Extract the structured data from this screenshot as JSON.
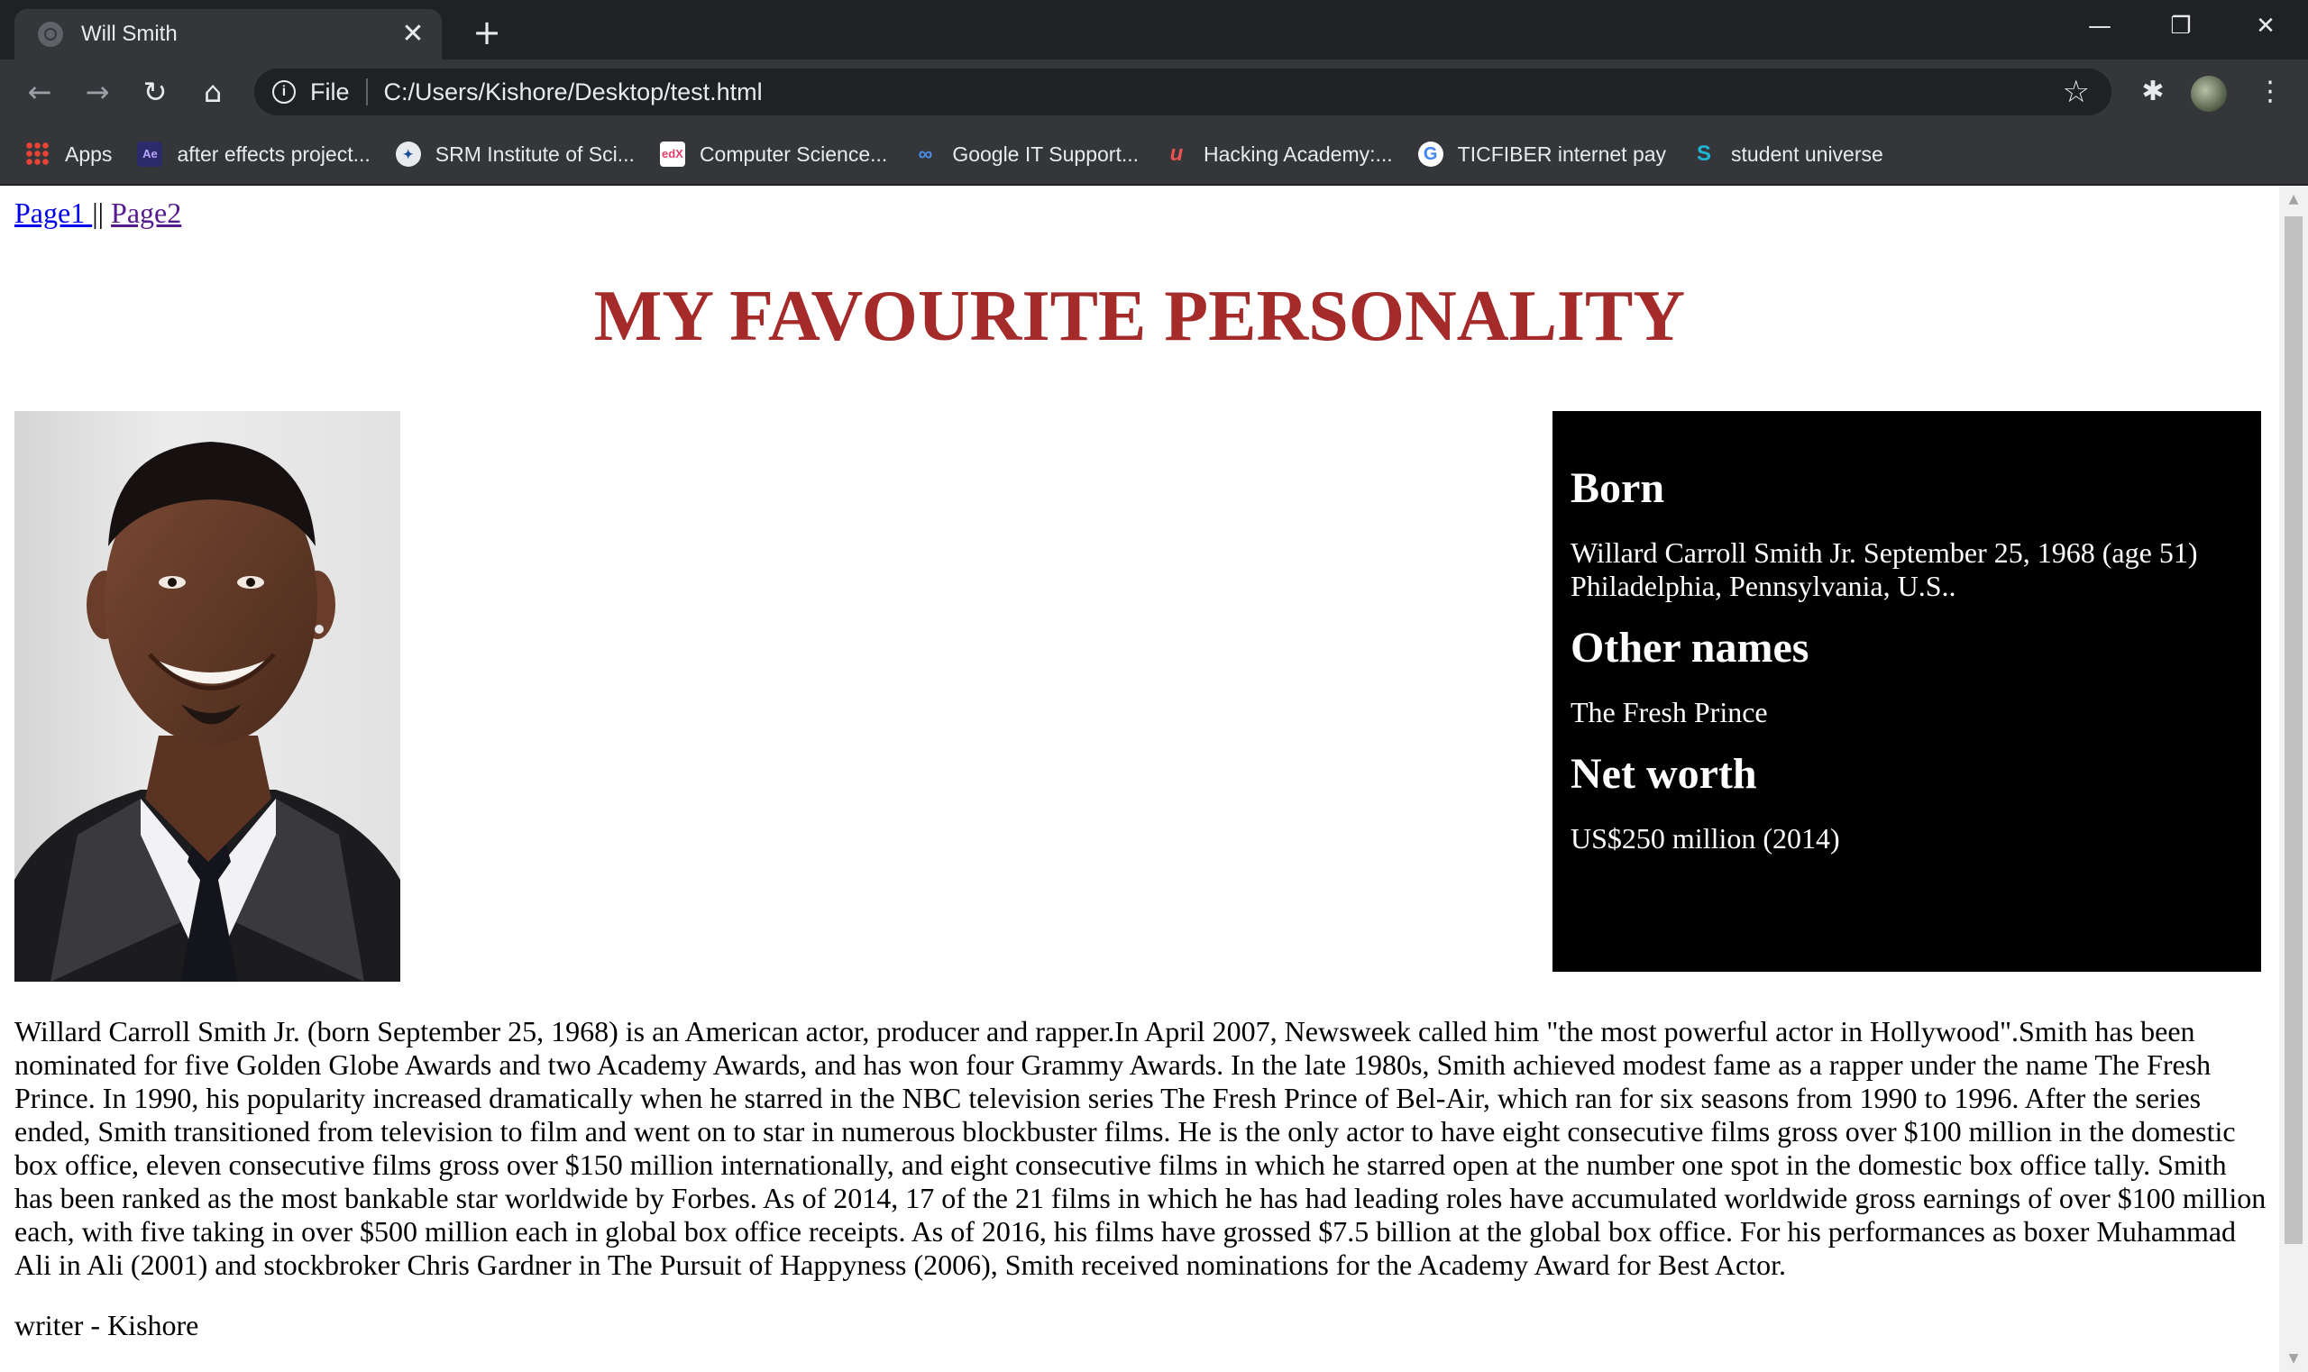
{
  "browser": {
    "tab_title": "Will Smith",
    "url_scheme": "File",
    "url": "C:/Users/Kishore/Desktop/test.html",
    "bookmarks": [
      {
        "label": "Apps",
        "icon": "apps-grid-icon"
      },
      {
        "label": "after effects project...",
        "icon": "after-effects-icon"
      },
      {
        "label": "SRM Institute of Sci...",
        "icon": "srm-icon"
      },
      {
        "label": "Computer Science...",
        "icon": "edx-icon"
      },
      {
        "label": "Google IT Support...",
        "icon": "coursera-icon"
      },
      {
        "label": "Hacking Academy:...",
        "icon": "udemy-icon"
      },
      {
        "label": "TICFIBER internet pay",
        "icon": "google-icon"
      },
      {
        "label": "student universe",
        "icon": "student-universe-icon"
      }
    ]
  },
  "page": {
    "nav": {
      "link1": "Page1 ",
      "separator": "||",
      "link2": "Page2"
    },
    "headline": "MY FAVOURITE PERSONALITY",
    "infobox": {
      "born_heading": "Born",
      "born_text": "Willard Carroll Smith Jr. September 25, 1968 (age 51) Philadelphia, Pennsylvania, U.S..",
      "other_names_heading": "Other names",
      "other_names_text": "The Fresh Prince",
      "net_worth_heading": "Net worth",
      "net_worth_text": "US$250 million (2014)"
    },
    "bio": "Willard Carroll Smith Jr. (born September 25, 1968) is an American actor, producer and rapper.In April 2007, Newsweek called him \"the most powerful actor in Hollywood\".Smith has been nominated for five Golden Globe Awards and two Academy Awards, and has won four Grammy Awards. In the late 1980s, Smith achieved modest fame as a rapper under the name The Fresh Prince. In 1990, his popularity increased dramatically when he starred in the NBC television series The Fresh Prince of Bel-Air, which ran for six seasons from 1990 to 1996. After the series ended, Smith transitioned from television to film and went on to star in numerous blockbuster films. He is the only actor to have eight consecutive films gross over $100 million in the domestic box office, eleven consecutive films gross over $150 million internationally, and eight consecutive films in which he starred open at the number one spot in the domestic box office tally. Smith has been ranked as the most bankable star worldwide by Forbes. As of 2014, 17 of the 21 films in which he has had leading roles have accumulated worldwide gross earnings of over $100 million each, with five taking in over $500 million each in global box office receipts. As of 2016, his films have grossed $7.5 billion at the global box office. For his performances as boxer Muhammad Ali in Ali (2001) and stockbroker Chris Gardner in The Pursuit of Happyness (2006), Smith received nominations for the Academy Award for Best Actor.",
    "writer": "writer - Kishore"
  },
  "colors": {
    "headline": "#a52a2a",
    "link": "#0000ee",
    "visited_link": "#551a8b",
    "infobox_bg": "#000000",
    "chrome_dark": "#202124",
    "chrome": "#35363a"
  }
}
